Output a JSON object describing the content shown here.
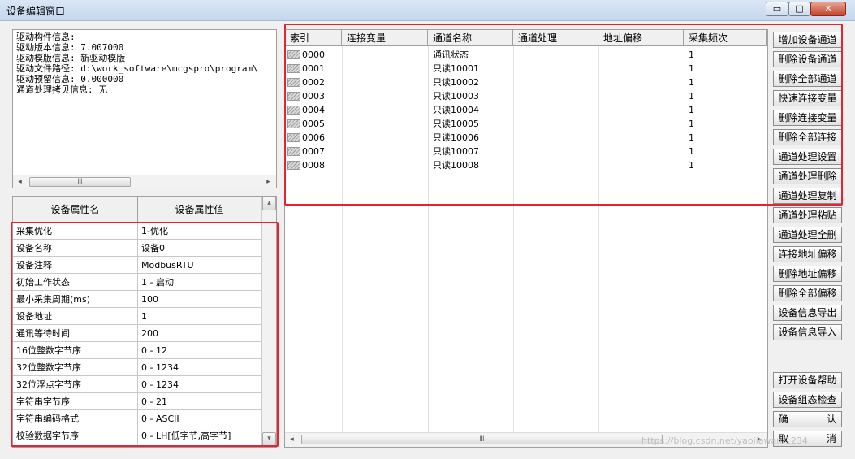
{
  "window": {
    "title": "设备编辑窗口",
    "controls": {
      "minimize": "▭",
      "maximize": "□",
      "close": "✕"
    }
  },
  "info": {
    "lines": [
      "驱动构件信息:",
      "驱动版本信息: 7.007000",
      "驱动模版信息: 新驱动模版",
      "驱动文件路径: d:\\work_software\\mcgspro\\program\\",
      "驱动预留信息: 0.000000",
      "通道处理拷贝信息: 无"
    ]
  },
  "properties": {
    "headers": [
      "设备属性名",
      "设备属性值"
    ],
    "rows": [
      {
        "name": "采集优化",
        "value": "1-优化"
      },
      {
        "name": "设备名称",
        "value": "设备0"
      },
      {
        "name": "设备注释",
        "value": "ModbusRTU"
      },
      {
        "name": "初始工作状态",
        "value": "1 - 启动"
      },
      {
        "name": "最小采集周期(ms)",
        "value": "100"
      },
      {
        "name": "设备地址",
        "value": "1"
      },
      {
        "name": "通讯等待时间",
        "value": "200"
      },
      {
        "name": "16位整数字节序",
        "value": "0 - 12"
      },
      {
        "name": "32位整数字节序",
        "value": "0 - 1234"
      },
      {
        "name": "32位浮点字节序",
        "value": "0 - 1234"
      },
      {
        "name": "字符串字节序",
        "value": "0 - 21"
      },
      {
        "name": "字符串编码格式",
        "value": "0 - ASCII"
      },
      {
        "name": "校验数据字节序",
        "value": "0 - LH[低字节,高字节]"
      }
    ]
  },
  "channels": {
    "headers": [
      "索引",
      "连接变量",
      "通道名称",
      "通道处理",
      "地址偏移",
      "采集频次"
    ],
    "rows": [
      {
        "index": "0000",
        "var": "",
        "name": "通讯状态",
        "proc": "",
        "offset": "",
        "freq": "1"
      },
      {
        "index": "0001",
        "var": "",
        "name": "只读10001",
        "proc": "",
        "offset": "",
        "freq": "1"
      },
      {
        "index": "0002",
        "var": "",
        "name": "只读10002",
        "proc": "",
        "offset": "",
        "freq": "1"
      },
      {
        "index": "0003",
        "var": "",
        "name": "只读10003",
        "proc": "",
        "offset": "",
        "freq": "1"
      },
      {
        "index": "0004",
        "var": "",
        "name": "只读10004",
        "proc": "",
        "offset": "",
        "freq": "1"
      },
      {
        "index": "0005",
        "var": "",
        "name": "只读10005",
        "proc": "",
        "offset": "",
        "freq": "1"
      },
      {
        "index": "0006",
        "var": "",
        "name": "只读10006",
        "proc": "",
        "offset": "",
        "freq": "1"
      },
      {
        "index": "0007",
        "var": "",
        "name": "只读10007",
        "proc": "",
        "offset": "",
        "freq": "1"
      },
      {
        "index": "0008",
        "var": "",
        "name": "只读10008",
        "proc": "",
        "offset": "",
        "freq": "1"
      }
    ]
  },
  "buttons": [
    "增加设备通道",
    "删除设备通道",
    "删除全部通道",
    "快速连接变量",
    "删除连接变量",
    "删除全部连接",
    "通道处理设置",
    "通道处理删除",
    "通道处理复制",
    "通道处理粘贴",
    "通道处理全删",
    "连接地址偏移",
    "删除地址偏移",
    "删除全部偏移",
    "设备信息导出",
    "设备信息导入",
    "打开设备帮助",
    "设备组态检查"
  ],
  "confirm_button": [
    "确",
    "认"
  ],
  "cancel_button": [
    "取",
    "消"
  ],
  "scroll_glyphs": {
    "left": "◂",
    "right": "▸",
    "up": "▴",
    "down": "▾",
    "grip": "Ⅲ"
  },
  "watermark": "https://blog.csdn.net/yaojiawan/1234",
  "colors": {
    "annotation_red": "#e8222e",
    "titlebar": "#c4d6ee"
  }
}
